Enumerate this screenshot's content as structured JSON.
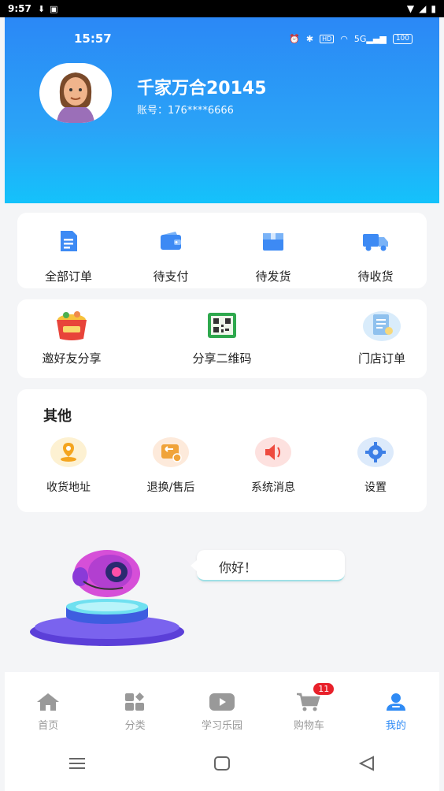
{
  "system_status": {
    "time": "9:57"
  },
  "inner_status": {
    "time": "15:57",
    "battery": "100"
  },
  "profile": {
    "name": "千家万合20145",
    "account": "账号：176****6666"
  },
  "orders": [
    {
      "label": "全部订单",
      "icon": "document-icon"
    },
    {
      "label": "待支付",
      "icon": "wallet-icon"
    },
    {
      "label": "待发货",
      "icon": "box-icon"
    },
    {
      "label": "待收货",
      "icon": "truck-icon"
    }
  ],
  "shares": [
    {
      "label": "邀好友分享",
      "icon": "gift-bag-icon"
    },
    {
      "label": "分享二维码",
      "icon": "qr-code-icon"
    },
    {
      "label": "门店订单",
      "icon": "store-order-icon"
    }
  ],
  "other": {
    "title": "其他",
    "items": [
      {
        "label": "收货地址",
        "icon": "location-icon"
      },
      {
        "label": "退换/售后",
        "icon": "return-icon"
      },
      {
        "label": "系统消息",
        "icon": "speaker-icon"
      },
      {
        "label": "设置",
        "icon": "gear-icon"
      }
    ]
  },
  "assistant": {
    "greeting": "你好！"
  },
  "tabbar": {
    "items": [
      {
        "label": "首页",
        "icon": "home-icon"
      },
      {
        "label": "分类",
        "icon": "category-icon"
      },
      {
        "label": "学习乐园",
        "icon": "video-icon"
      },
      {
        "label": "购物车",
        "icon": "cart-icon",
        "badge": "11"
      },
      {
        "label": "我的",
        "icon": "user-icon",
        "active": true
      }
    ]
  },
  "colors": {
    "primary": "#2f8bf5",
    "badge": "#e8202a",
    "header_top": "#2b88f6",
    "header_bottom": "#14c2fb"
  }
}
